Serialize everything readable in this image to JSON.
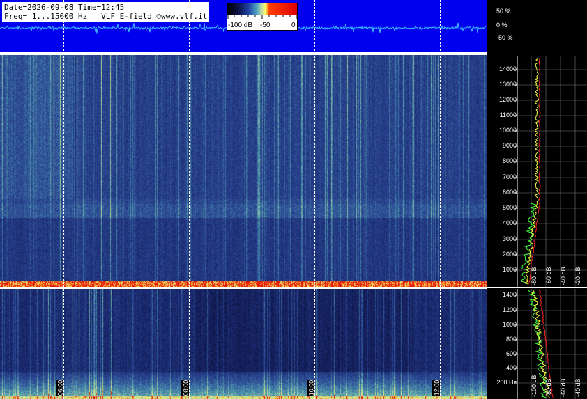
{
  "header": {
    "info_line1": "Date=2026-09-08 Time=12:45",
    "info_line2": "Freq= 1...15000 Hz   VLF E-field ©www.vlf.it"
  },
  "colorbar": {
    "labels": [
      "-100 dB",
      "-50",
      "0"
    ]
  },
  "waveform_axis": {
    "labels": [
      "50 %",
      "0 %",
      "-50 %"
    ]
  },
  "time_axis": {
    "labels": [
      "06:00",
      "08:00",
      "10:00",
      "12:00"
    ]
  },
  "upper_freq_axis": {
    "labels": [
      "14000",
      "13000",
      "12000",
      "11000",
      "10000",
      "9000",
      "8000",
      "7000",
      "6000",
      "5000",
      "4000",
      "3000",
      "2000",
      "1000"
    ]
  },
  "lower_freq_axis": {
    "labels": [
      "1400",
      "1200",
      "1000",
      "800",
      "600",
      "400",
      "200 Hz"
    ]
  },
  "db_axis": {
    "upper_labels": [
      "-80 dB",
      "-60 dB",
      "-40 dB",
      "-20 dB"
    ],
    "lower_labels": [
      "-100 dB",
      "-80 dB",
      "-60 dB",
      "-40 dB",
      "-20 dB"
    ]
  },
  "colors": {
    "waveform_bg": "#0000ee",
    "spectrum_mean": "#ffff40",
    "spectrum_peak": "#ff2020",
    "spectrum_min": "#40ff40"
  }
}
